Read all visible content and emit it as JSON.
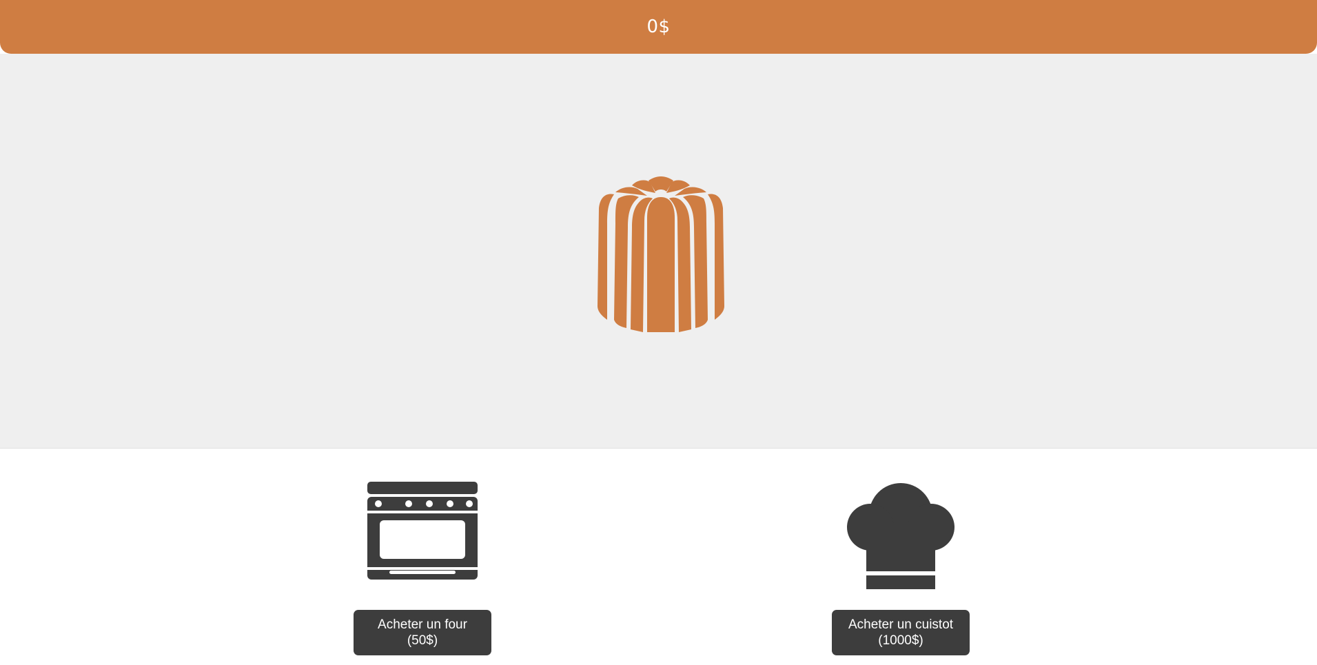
{
  "header": {
    "balance": "0$"
  },
  "shop": {
    "items": [
      {
        "icon": "oven-icon",
        "label_line1": "Acheter un four",
        "label_line2": "(50$)"
      },
      {
        "icon": "chef-hat-icon",
        "label_line1": "Acheter un cuistot",
        "label_line2": "(1000$)"
      }
    ]
  },
  "colors": {
    "accent": "#cf7d42",
    "stage_background": "#efefef",
    "dark": "#3d3d3d"
  }
}
